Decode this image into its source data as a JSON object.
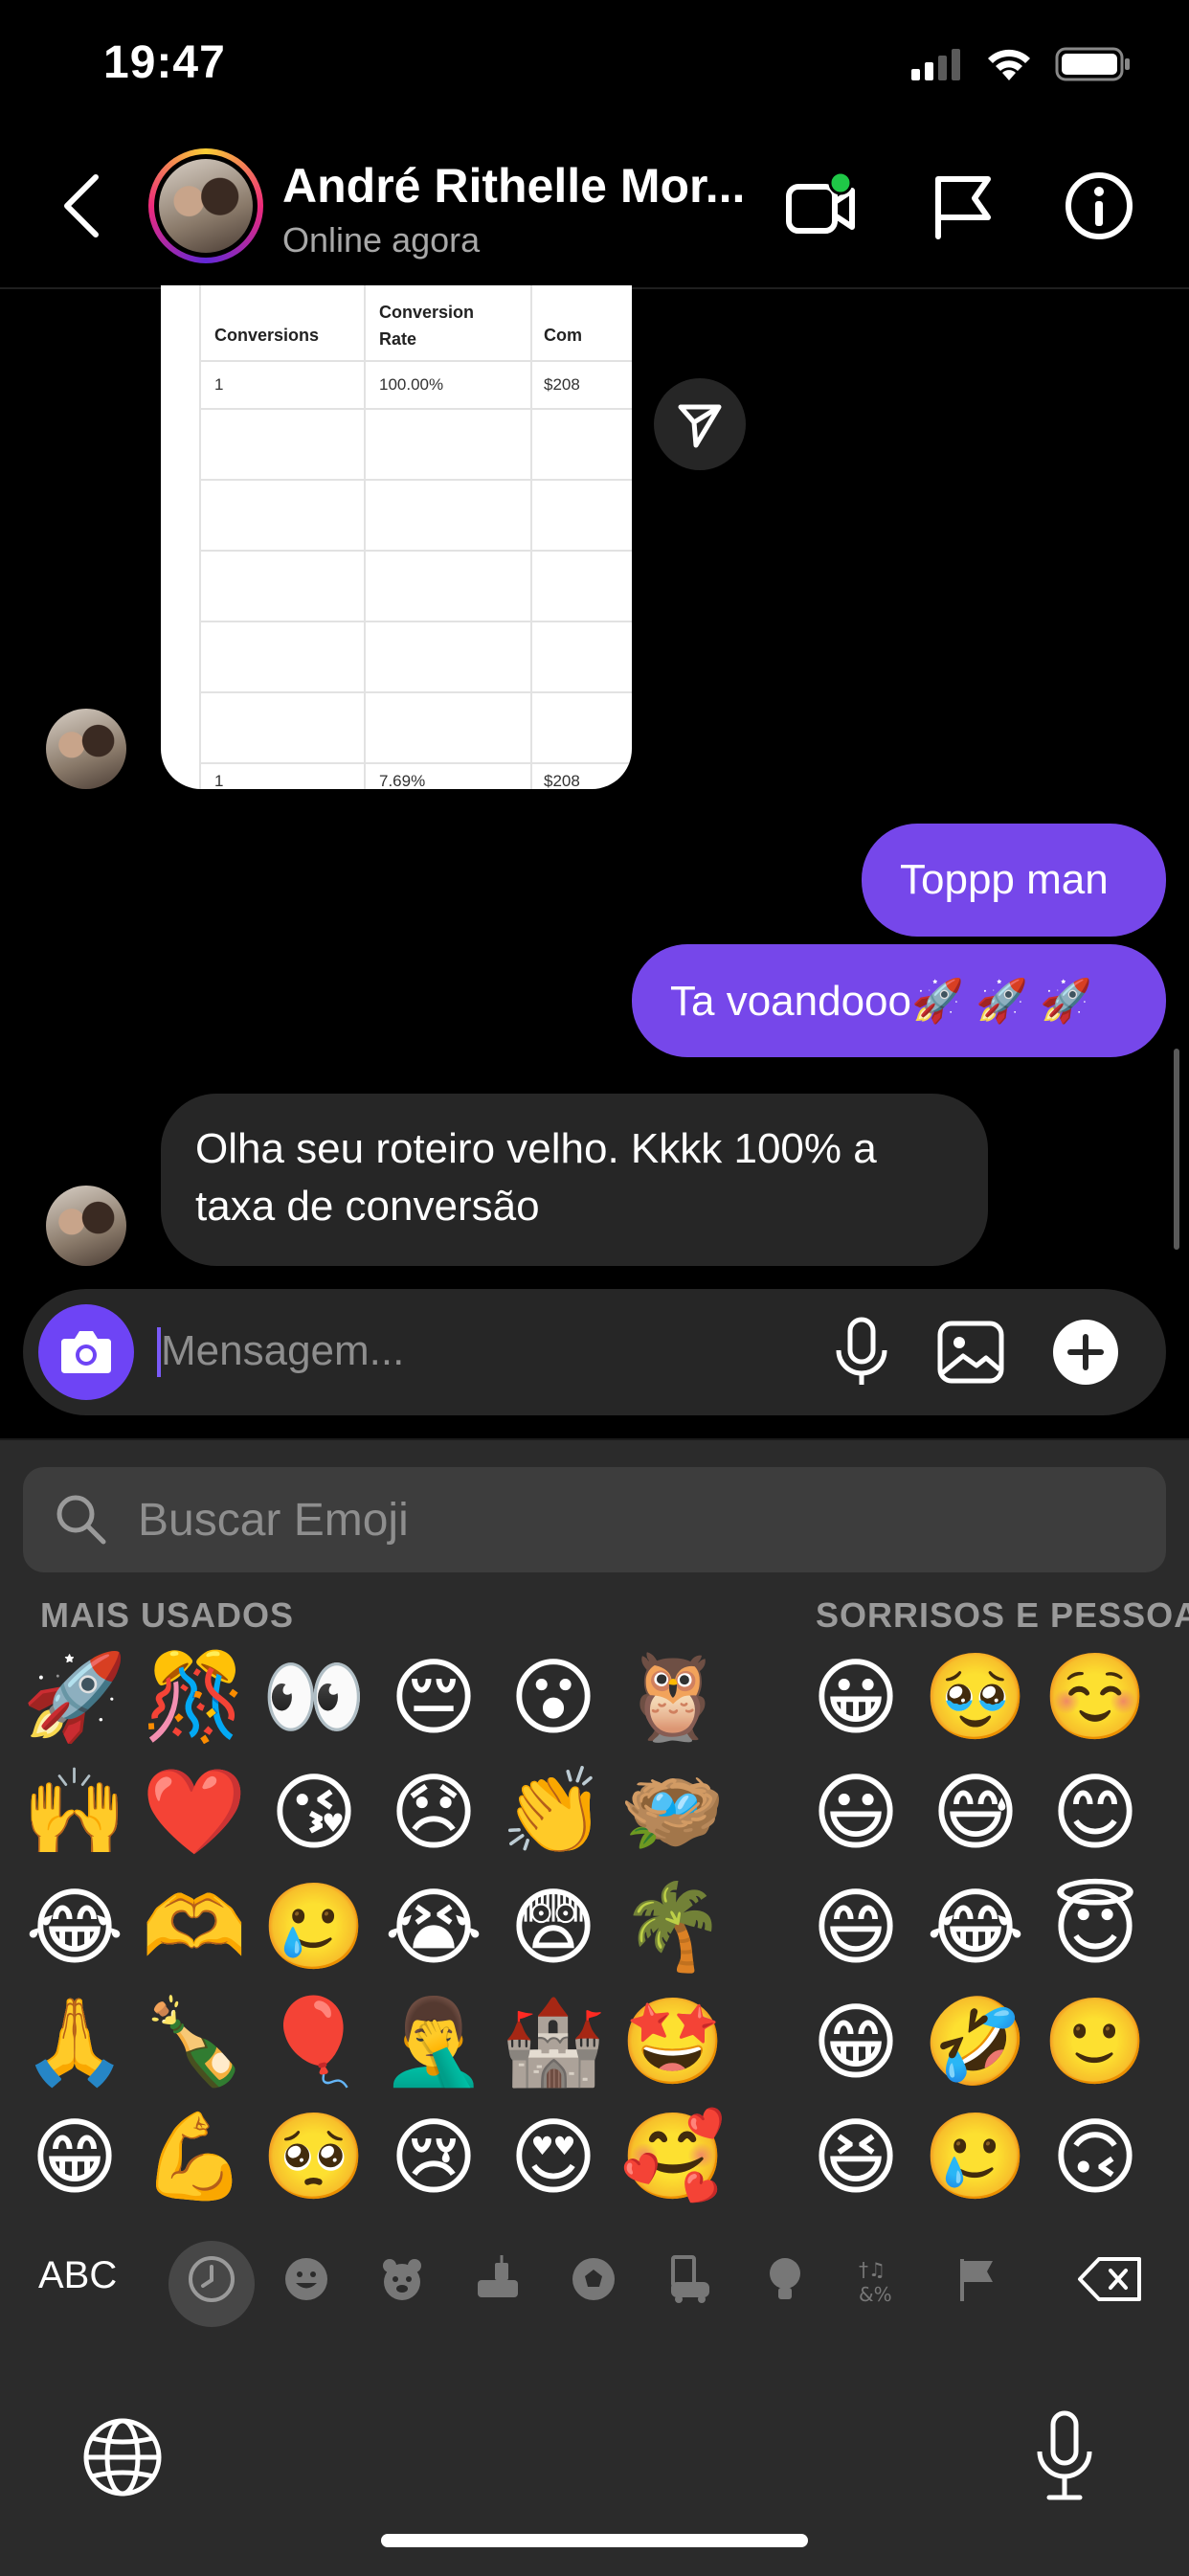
{
  "status_bar": {
    "time": "19:47"
  },
  "header": {
    "contact_name": "André Rithelle Mor...",
    "status": "Online agora",
    "video_call_active_color": "#1fc847"
  },
  "table_preview": {
    "headers": [
      "Conversions",
      "Conversion Rate",
      "Com"
    ],
    "rows": [
      [
        "1",
        "100.00%",
        "$208"
      ],
      [
        "1",
        "7.69%",
        "$208"
      ]
    ]
  },
  "messages": {
    "outgoing": [
      "Toppp man",
      "Ta voandooo🚀 🚀 🚀"
    ],
    "incoming_text": "Olha seu roteiro velho. Kkkk 100% a taxa de conversão"
  },
  "composer": {
    "placeholder": "Mensagem..."
  },
  "emoji_keyboard": {
    "search_placeholder": "Buscar Emoji",
    "section_frequent": "MAIS USADOS",
    "section_smileys": "SORRISOS E PESSOAS",
    "frequent": [
      [
        "🚀",
        "🎊",
        "👀",
        "😔",
        "😮",
        "🦉"
      ],
      [
        "🙌",
        "❤️",
        "😘",
        "😞",
        "👏",
        "🪺"
      ],
      [
        "😂",
        "🫶",
        "🥲",
        "😭",
        "😨",
        "🌴"
      ],
      [
        "🙏",
        "🍾",
        "🎈",
        "🤦‍♂️",
        "🏰",
        "🤩"
      ],
      [
        "😁",
        "💪",
        "🥺",
        "😢",
        "😍",
        "🥰"
      ]
    ],
    "smileys": [
      [
        "😀",
        "🥹",
        "☺️"
      ],
      [
        "😃",
        "😅",
        "😊"
      ],
      [
        "😄",
        "😂",
        "😇"
      ],
      [
        "😁",
        "🤣",
        "🙂"
      ],
      [
        "😆",
        "🥲",
        "🙃"
      ]
    ],
    "abc_label": "ABC",
    "accent_color": "#7647ea"
  }
}
